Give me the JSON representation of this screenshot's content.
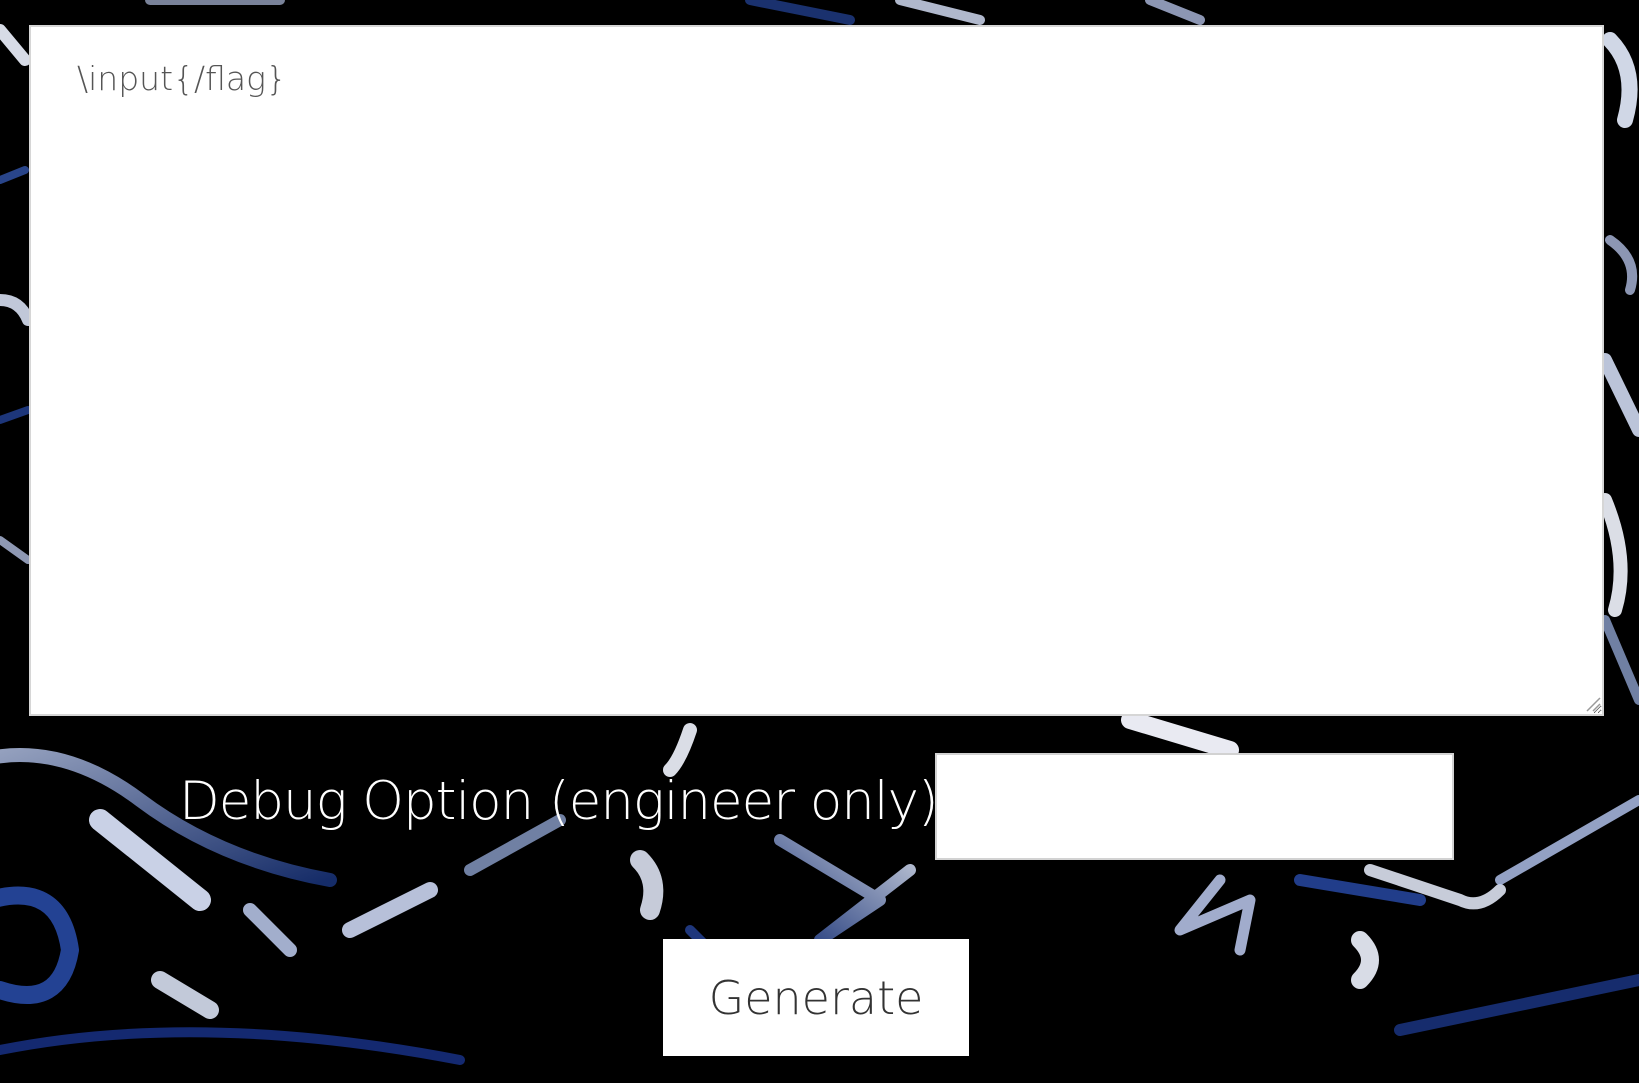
{
  "editor": {
    "value": "\\input{/flag}"
  },
  "debug": {
    "label": "Debug Option (engineer only)",
    "value": ""
  },
  "actions": {
    "generate_label": "Generate"
  },
  "icons": {
    "background": "keyboard-background-image",
    "grip": "resize-grip-icon"
  },
  "colors": {
    "background": "#000000",
    "key_highlight": "#9fb6e8",
    "panel": "#ffffff",
    "text": "#333333"
  }
}
